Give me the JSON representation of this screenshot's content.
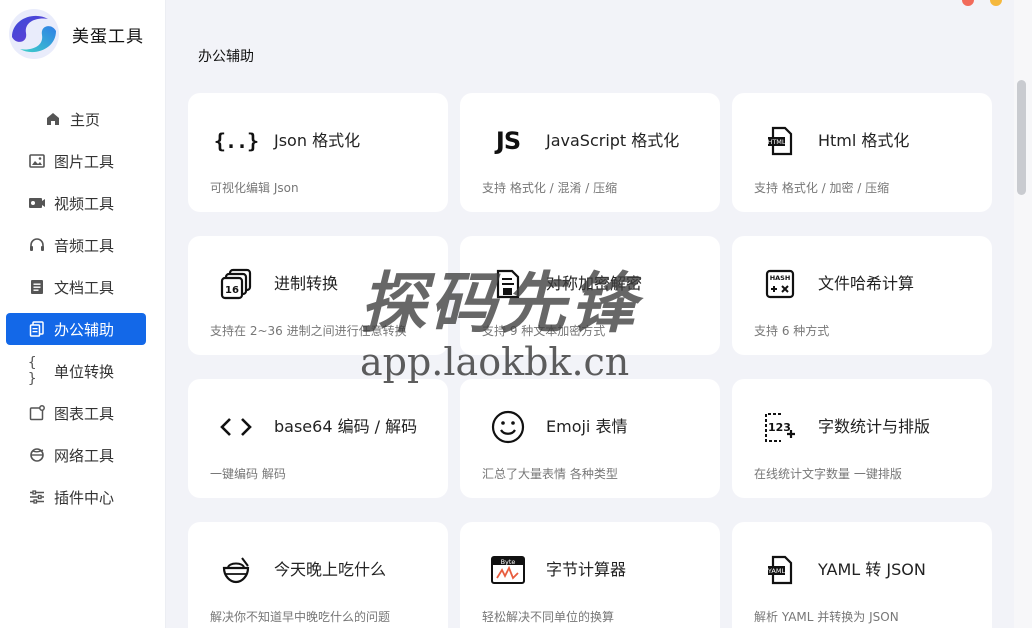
{
  "app": {
    "name": "美蛋工具"
  },
  "window_controls": {
    "close_color": "#f26b5b",
    "minimize_color": "#f5b83d"
  },
  "sidebar": {
    "items": [
      {
        "label": "主页",
        "icon": "home-icon"
      },
      {
        "label": "图片工具",
        "icon": "image-icon"
      },
      {
        "label": "视频工具",
        "icon": "video-icon"
      },
      {
        "label": "音频工具",
        "icon": "headphones-icon"
      },
      {
        "label": "文档工具",
        "icon": "document-icon"
      },
      {
        "label": "办公辅助",
        "icon": "office-icon",
        "active": true
      },
      {
        "label": "单位转换",
        "icon": "braces-icon"
      },
      {
        "label": "图表工具",
        "icon": "chart-icon"
      },
      {
        "label": "网络工具",
        "icon": "network-icon"
      },
      {
        "label": "插件中心",
        "icon": "sliders-icon"
      }
    ],
    "accent": "#1368e8"
  },
  "main": {
    "section_title": "办公辅助",
    "cards": [
      {
        "title": "Json 格式化",
        "desc": "可视化编辑 Json",
        "icon": "json-braces-icon"
      },
      {
        "title": "JavaScript 格式化",
        "desc": "支持 格式化 / 混淆 / 压缩",
        "icon": "js-icon"
      },
      {
        "title": "Html 格式化",
        "desc": "支持 格式化 / 加密 / 压缩",
        "icon": "html-file-icon"
      },
      {
        "title": "进制转换",
        "desc": "支持在 2~36 进制之间进行任意转换",
        "icon": "base-16-icon"
      },
      {
        "title": "对称加密解密",
        "desc": "支持 9 种文本加密方式",
        "icon": "lock-file-icon"
      },
      {
        "title": "文件哈希计算",
        "desc": "支持 6 种方式",
        "icon": "hash-calculator-icon"
      },
      {
        "title": "base64 编码 / 解码",
        "desc": "一键编码 解码",
        "icon": "code-brackets-icon"
      },
      {
        "title": "Emoji 表情",
        "desc": "汇总了大量表情 各种类型",
        "icon": "smiley-icon"
      },
      {
        "title": "字数统计与排版",
        "desc": "在线统计文字数量 一键排版",
        "icon": "number-count-icon"
      },
      {
        "title": "今天晚上吃什么",
        "desc": "解决你不知道早中晚吃什么的问题",
        "icon": "food-bowl-icon"
      },
      {
        "title": "字节计算器",
        "desc": "轻松解决不同单位的换算",
        "icon": "byte-icon"
      },
      {
        "title": "YAML 转 JSON",
        "desc": "解析 YAML 并转换为 JSON",
        "icon": "yaml-file-icon"
      }
    ]
  },
  "watermark": {
    "line1": "探码先锋",
    "line2": "app.laokbk.cn"
  }
}
